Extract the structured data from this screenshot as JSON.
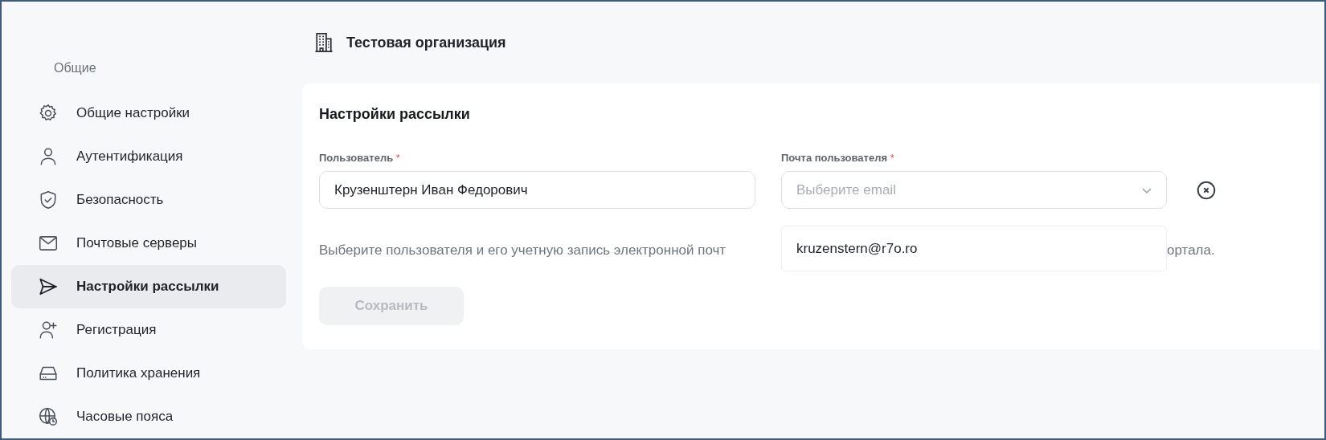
{
  "header": {
    "title": "Тестовая организация"
  },
  "sidebar": {
    "section": "Общие",
    "items": [
      {
        "label": "Общие настройки",
        "kind": "gear",
        "selected": false
      },
      {
        "label": "Аутентификация",
        "kind": "user",
        "selected": false
      },
      {
        "label": "Безопасность",
        "kind": "shield",
        "selected": false
      },
      {
        "label": "Почтовые серверы",
        "kind": "mail",
        "selected": false
      },
      {
        "label": "Настройки рассылки",
        "kind": "send",
        "selected": true
      },
      {
        "label": "Регистрация",
        "kind": "userplus",
        "selected": false
      },
      {
        "label": "Политика хранения",
        "kind": "drive",
        "selected": false
      },
      {
        "label": "Часовые пояса",
        "kind": "globe",
        "selected": false
      }
    ]
  },
  "card": {
    "title": "Настройки рассылки",
    "user_field": {
      "label": "Пользователь",
      "required_mark": "*",
      "value": "Крузенштерн Иван Федорович"
    },
    "email_field": {
      "label": "Почта пользователя",
      "required_mark": "*",
      "placeholder": "Выберите email",
      "options": [
        "kruzenstern@r7o.ro"
      ]
    },
    "hint_start": "Выберите пользователя и его учетную запись электронной почт",
    "hint_end": "ортала.",
    "save_button": {
      "label": "Сохранить",
      "disabled": true
    }
  }
}
